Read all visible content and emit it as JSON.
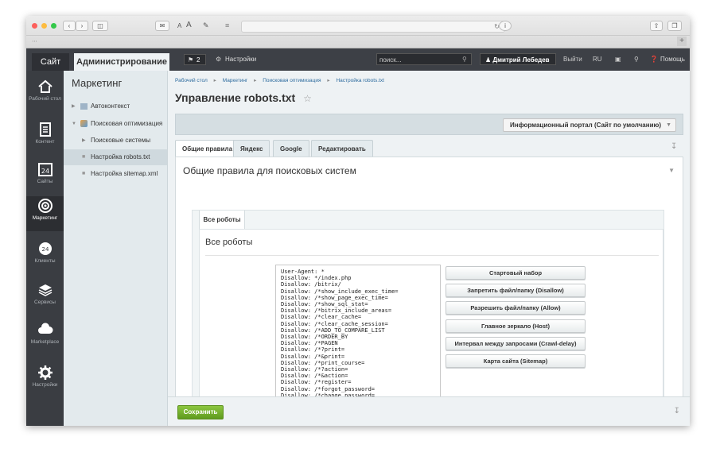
{
  "colors": {
    "topbar": "#3d4046",
    "rail": "#3a3d42",
    "menu_bg": "#e3eaed",
    "content_bg": "#eef2f4",
    "link": "#2d6b9e",
    "save_green": "#7cb82f"
  },
  "browser": {
    "text_size_small": "A",
    "text_size_large": "A"
  },
  "topbar": {
    "site_tab": "Сайт",
    "admin_tab": "Администрирование",
    "notifications_count": "2",
    "settings_label": "Настройки",
    "search_placeholder": "поиск...",
    "user_name": "Дмитрий Лебедев",
    "logout": "Выйти",
    "language": "RU",
    "help": "Помощь"
  },
  "rail": [
    {
      "label": "Рабочий стол",
      "icon": "home-icon"
    },
    {
      "label": "Контент",
      "icon": "document-icon"
    },
    {
      "label": "Сайты",
      "icon": "calendar-icon"
    },
    {
      "label": "Маркетинг",
      "icon": "target-icon"
    },
    {
      "label": "Клиенты",
      "icon": "clients-icon"
    },
    {
      "label": "Сервисы",
      "icon": "layers-icon"
    },
    {
      "label": "Marketplace",
      "icon": "cloud-icon"
    },
    {
      "label": "Настройки",
      "icon": "gear-icon"
    }
  ],
  "menu": {
    "title": "Маркетинг",
    "items": [
      {
        "label": "Автоконтекст"
      },
      {
        "label": "Поисковая оптимизация"
      },
      {
        "label": "Поисковые системы"
      },
      {
        "label": "Настройка robots.txt"
      },
      {
        "label": "Настройка sitemap.xml"
      }
    ]
  },
  "breadcrumb": [
    "Рабочий стол",
    "Маркетинг",
    "Поисковая оптимизация",
    "Настройка robots.txt"
  ],
  "page_title": "Управление robots.txt",
  "site_selector": "Информационный портал (Сайт по умолчанию)",
  "tabs": [
    "Общие правила",
    "Яндекс",
    "Google",
    "Редактировать"
  ],
  "panel_title": "Общие правила для поисковых систем",
  "inner_tab": "Все роботы",
  "inner_title": "Все роботы",
  "robots_text": "User-Agent: *\nDisallow: */index.php\nDisallow: /bitrix/\nDisallow: /*show_include_exec_time=\nDisallow: /*show_page_exec_time=\nDisallow: /*show_sql_stat=\nDisallow: /*bitrix_include_areas=\nDisallow: /*clear_cache=\nDisallow: /*clear_cache_session=\nDisallow: /*ADD_TO_COMPARE_LIST\nDisallow: /*ORDER_BY\nDisallow: /*PAGEN\nDisallow: /*?print=\nDisallow: /*&print=\nDisallow: /*print_course=\nDisallow: /*?action=\nDisallow: /*&action=\nDisallow: /*register=\nDisallow: /*forgot_password=\nDisallow: /*change_password=\nDisallow: /*login=\nDisallow: /*logout=\nDisallow: /*auth=",
  "actions": [
    "Стартовый набор",
    "Запретить файл/папку (Disallow)",
    "Разрешить файл/папку (Allow)",
    "Главное зеркало (Host)",
    "Интервал между запросами (Crawl-delay)",
    "Карта сайта (Sitemap)"
  ],
  "save_button": "Сохранить"
}
